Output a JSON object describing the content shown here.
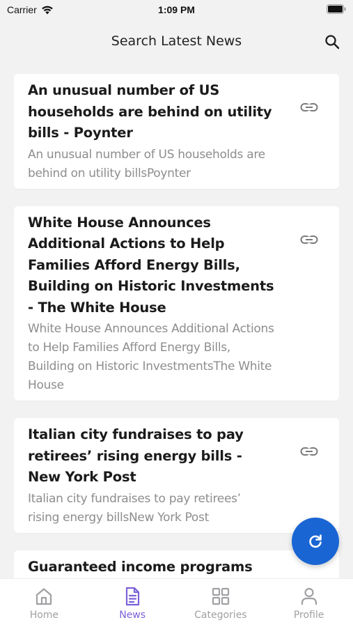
{
  "status_bar": {
    "carrier": "Carrier",
    "time": "1:09 PM"
  },
  "header": {
    "title": "Search Latest News"
  },
  "articles": [
    {
      "title": "An unusual number of US households are behind on utility bills - Poynter",
      "description": "An unusual number of US households are behind on utility billsPoynter"
    },
    {
      "title": "White House Announces Additional Actions to Help Families Afford Energy Bills, Building on Historic Investments - The White House",
      "description": "White House Announces Additional Actions to Help Families Afford Energy Bills, Building on Historic InvestmentsThe White House"
    },
    {
      "title": "Italian city fundraises to pay retirees’ rising energy bills - New York Post",
      "description": "Italian city fundraises to pay retirees’ rising energy billsNew York Post"
    },
    {
      "title": "Guaranteed income programs are expanding across the nation",
      "description": ""
    }
  ],
  "tab_bar": {
    "tabs": [
      {
        "label": "Home",
        "icon": "home-icon"
      },
      {
        "label": "News",
        "icon": "news-icon"
      },
      {
        "label": "Categories",
        "icon": "categories-icon"
      },
      {
        "label": "Profile",
        "icon": "profile-icon"
      }
    ],
    "active": "News"
  },
  "colors": {
    "accent": "#7b61d9",
    "fab": "#1965d4",
    "inactive": "#a0a0a4"
  }
}
